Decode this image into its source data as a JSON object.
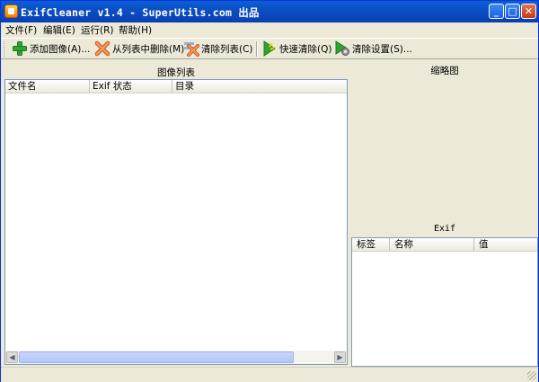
{
  "window": {
    "title": "ExifCleaner v1.4 - SuperUtils.com 出品",
    "controls": {
      "minimize": "_",
      "maximize": "□",
      "close": "✕"
    }
  },
  "menu": {
    "items": [
      "文件(F)",
      "编辑(E)",
      "运行(R)",
      "帮助(H)"
    ]
  },
  "toolbar": {
    "buttons": [
      {
        "label": "添加图像(A)...",
        "icon": "add-plus-icon"
      },
      {
        "label": "从列表中删除(M)",
        "icon": "remove-x-icon"
      },
      {
        "label": "清除列表(C)",
        "icon": "clear-list-icon"
      },
      {
        "label": "快速清除(Q)",
        "icon": "quick-clean-icon"
      },
      {
        "label": "清除设置(S)...",
        "icon": "clean-settings-icon"
      }
    ]
  },
  "image_list": {
    "title": "图像列表",
    "columns": [
      "文件名",
      "Exif 状态",
      "目录"
    ]
  },
  "thumbnail": {
    "title": "缩略图"
  },
  "exif": {
    "title": "Exif",
    "columns": [
      "标签",
      "名称",
      "值"
    ]
  },
  "colors": {
    "titlebar": "#0a5fd8",
    "window_bg": "#ece9d8",
    "add_icon": "#2ea52e",
    "remove_icon": "#e0763a"
  }
}
